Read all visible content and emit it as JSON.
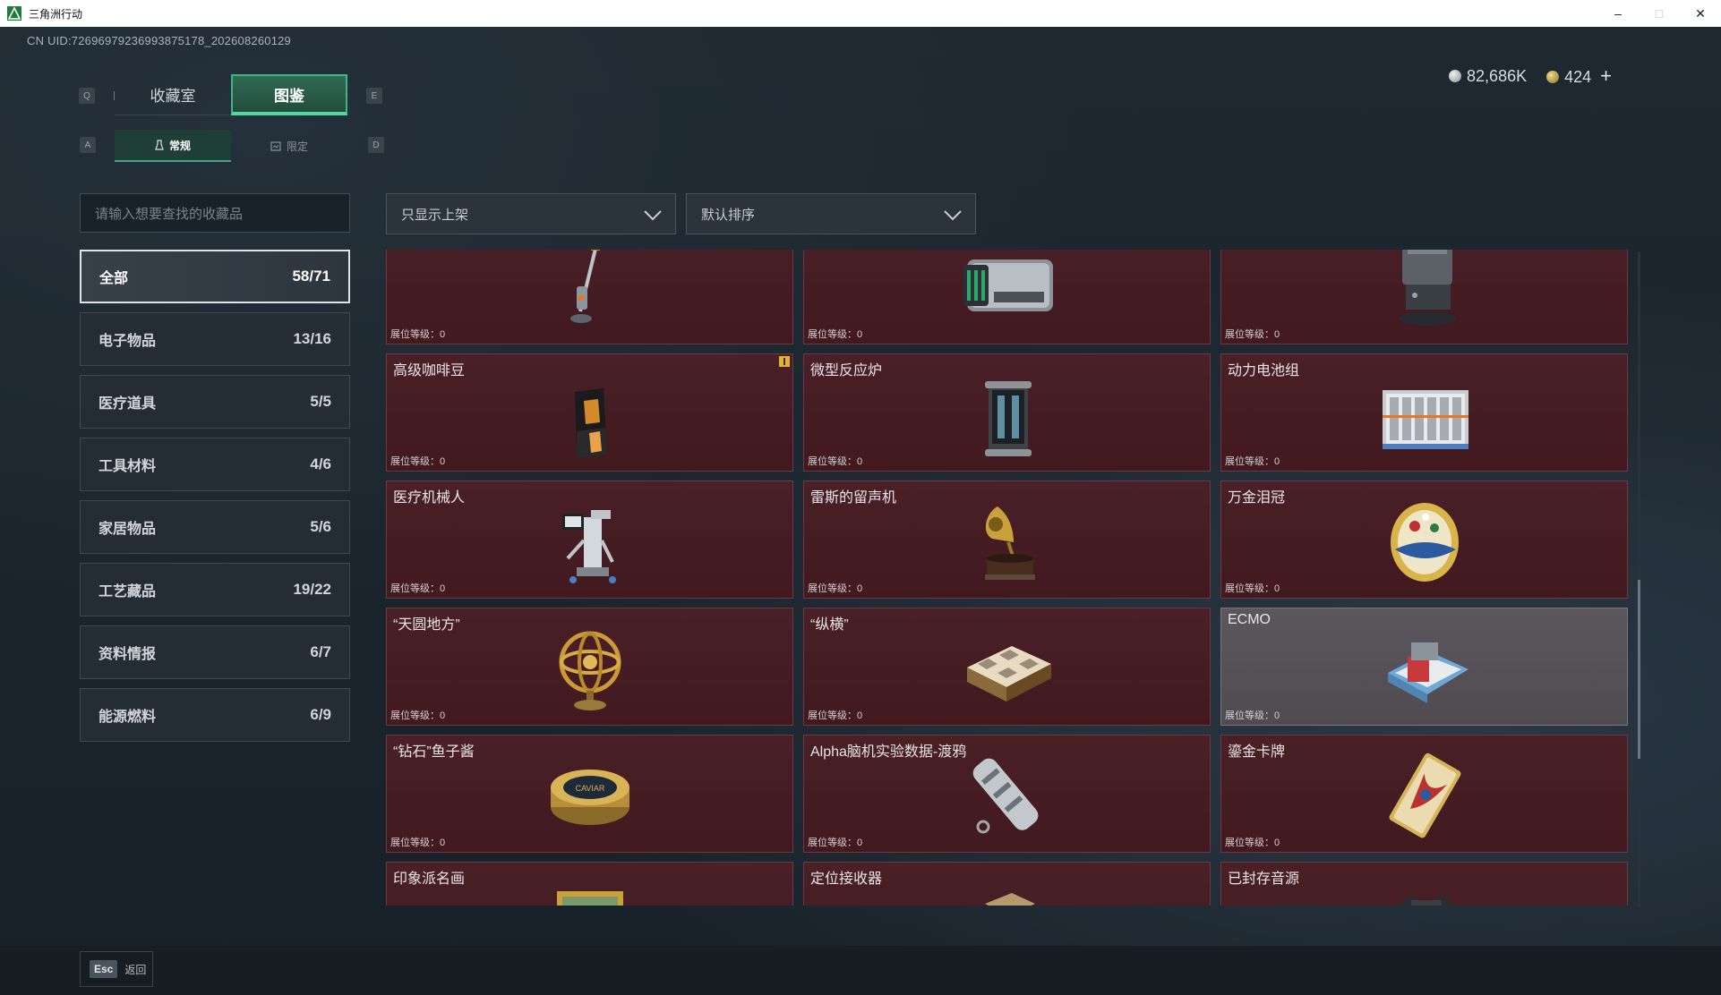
{
  "window": {
    "title": "三角洲行动",
    "controls": [
      "–",
      "□",
      "✕"
    ]
  },
  "uid": "CN UID:7269697923699387517​8_202608260129",
  "currency": {
    "silver": "82,686K",
    "gold": "424",
    "add": "+"
  },
  "keys": {
    "prev_tab": "Q",
    "next_tab": "E",
    "prev_sub": "A",
    "next_sub": "D"
  },
  "tabs": [
    {
      "label": "收藏室"
    },
    {
      "label": "图鉴"
    }
  ],
  "subtabs": [
    {
      "label": "常规"
    },
    {
      "label": "限定"
    }
  ],
  "search": {
    "placeholder": "请输入想要查找的收藏品"
  },
  "filter": {
    "selected": "只显示上架"
  },
  "sort": {
    "selected": "默认排序"
  },
  "categories": [
    {
      "label": "全部",
      "count": "58/71"
    },
    {
      "label": "电子物品",
      "count": "13/16"
    },
    {
      "label": "医疗道具",
      "count": "5/5"
    },
    {
      "label": "工具材料",
      "count": "4/6"
    },
    {
      "label": "家居物品",
      "count": "5/6"
    },
    {
      "label": "工艺藏品",
      "count": "19/22"
    },
    {
      "label": "资料情报",
      "count": "6/7"
    },
    {
      "label": "能源燃料",
      "count": "6/9"
    }
  ],
  "level_label": "展位等级：0",
  "items": [
    {
      "name": "",
      "icon": "vacuum-icon"
    },
    {
      "name": "",
      "icon": "server-icon"
    },
    {
      "name": "",
      "icon": "robot-vacuum-icon"
    },
    {
      "name": "高级咖啡豆",
      "icon": "coffee-bag-icon",
      "badge": true
    },
    {
      "name": "微型反应炉",
      "icon": "reactor-icon"
    },
    {
      "name": "动力电池组",
      "icon": "battery-pack-icon"
    },
    {
      "name": "医疗机械人",
      "icon": "medical-robot-icon"
    },
    {
      "name": "雷斯的留声机",
      "icon": "gramophone-icon"
    },
    {
      "name": "万金泪冠",
      "icon": "jeweled-egg-icon"
    },
    {
      "name": "“天圆地方”",
      "icon": "armillary-sphere-icon"
    },
    {
      "name": "“纵横”",
      "icon": "chessboard-icon"
    },
    {
      "name": "ECMO",
      "icon": "ecmo-icon",
      "gray": true
    },
    {
      "name": "“钻石”鱼子酱",
      "icon": "caviar-tin-icon"
    },
    {
      "name": "Alpha脑机实验数据-渡鸦",
      "icon": "data-canister-icon"
    },
    {
      "name": "鎏金卡牌",
      "icon": "gold-card-icon"
    },
    {
      "name": "印象派名画",
      "icon": "painting-icon"
    },
    {
      "name": "定位接收器",
      "icon": "receiver-icon"
    },
    {
      "name": "已封存音源",
      "icon": "sealed-audio-icon"
    }
  ],
  "caviar_label": "CAVIAR",
  "footer": {
    "esc_key": "Esc",
    "back_label": "返回"
  }
}
